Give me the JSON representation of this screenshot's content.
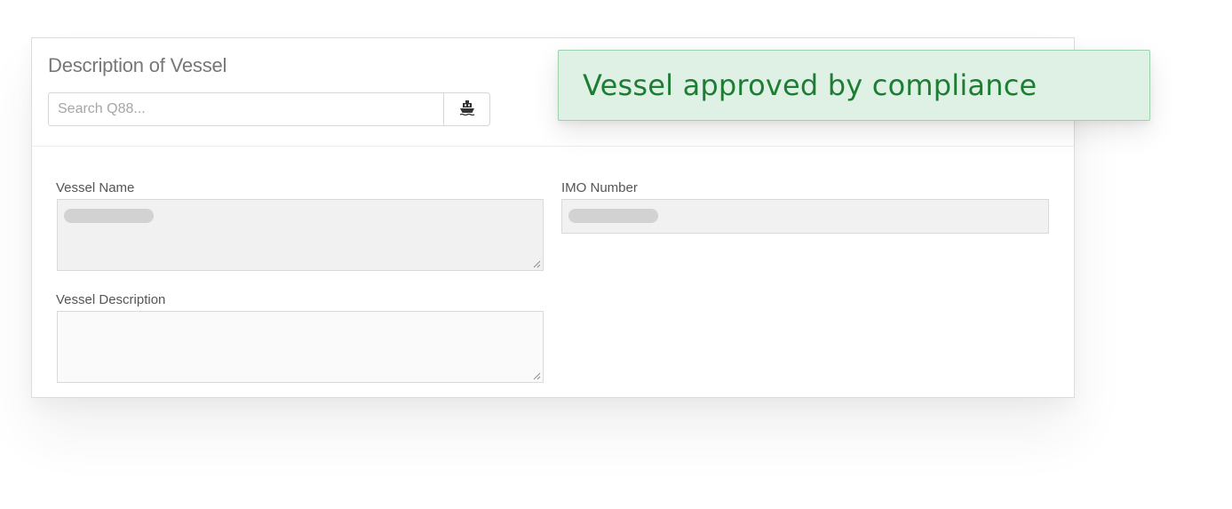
{
  "section": {
    "title": "Description of Vessel",
    "search": {
      "placeholder": "Search Q88...",
      "value": "",
      "button_icon": "ship-icon"
    }
  },
  "fields": {
    "vessel_name": {
      "label": "Vessel Name",
      "value": "",
      "redacted": true
    },
    "imo_number": {
      "label": "IMO Number",
      "value": "",
      "redacted": true
    },
    "vessel_description": {
      "label": "Vessel Description",
      "value": ""
    }
  },
  "toast": {
    "message": "Vessel approved by compliance",
    "status": "success",
    "colors": {
      "background": "#dff0e4",
      "border": "#9fd0ad",
      "text": "#1e7d34"
    }
  }
}
